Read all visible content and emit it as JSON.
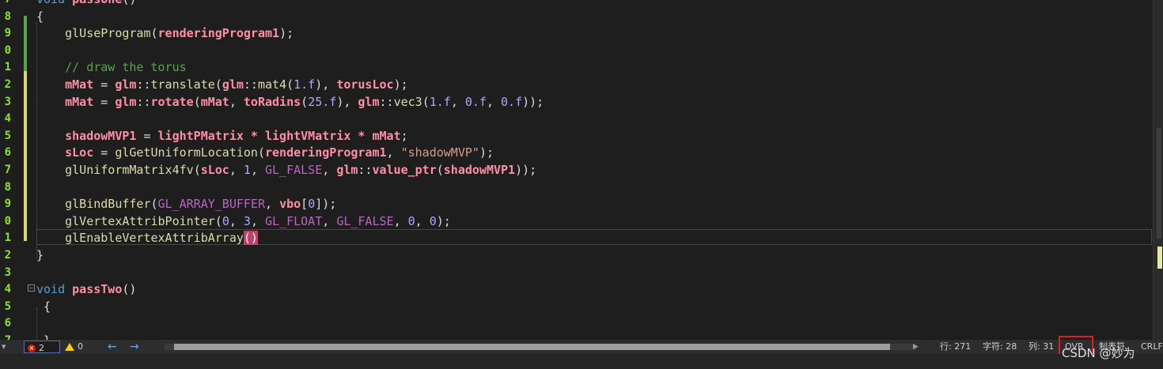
{
  "gutter": {
    "line_numbers": [
      "7",
      "8",
      "9",
      "0",
      "1",
      "2",
      "3",
      "4",
      "5",
      "6",
      "7",
      "8",
      "9",
      "0",
      "1",
      "2",
      "3",
      "4",
      "5",
      "6",
      "7"
    ]
  },
  "code": {
    "line0": {
      "kw": "void",
      "fn": "passOne",
      "rest": "()"
    },
    "line1": "{",
    "line2": {
      "fn": "glUseProgram",
      "p1": "(",
      "var": "renderingProgram1",
      "p2": ");"
    },
    "line4": "// draw the torus",
    "line5": {
      "v1": "mMat",
      "op": " = ",
      "ns": "glm",
      "sep": "::",
      "fn": "translate",
      "a": "(",
      "ns2": "glm",
      "sep2": "::",
      "fn2": "mat4",
      "b": "(",
      "n1": "1.f",
      "c": "), ",
      "v2": "torusLoc",
      "d": ");"
    },
    "line6": {
      "v1": "mMat",
      "op": " = ",
      "ns": "glm",
      "sep": "::",
      "fn": "rotate",
      "a": "(",
      "v2": "mMat",
      "b": ", ",
      "fn2": "toRadins",
      "c": "(",
      "n1": "25.f",
      "d": "), ",
      "ns2": "glm",
      "sep2": "::",
      "fn3": "vec3",
      "e": "(",
      "n2": "1.f",
      "f": ", ",
      "n3": "0.f",
      "g": ", ",
      "n4": "0.f",
      "h": "));"
    },
    "line8": {
      "v1": "shadowMVP1",
      "op": " = ",
      "v2": "lightPMatrix",
      "m1": " * ",
      "v3": "lightVMatrix",
      "m2": " * ",
      "v4": "mMat",
      "end": ";"
    },
    "line9": {
      "v1": "sLoc",
      "op": " = ",
      "fn": "glGetUniformLocation",
      "a": "(",
      "v2": "renderingProgram1",
      "b": ", ",
      "str": "\"shadowMVP\"",
      "c": ");"
    },
    "line10": {
      "fn": "glUniformMatrix4fv",
      "a": "(",
      "v1": "sLoc",
      "b": ", ",
      "n1": "1",
      "c": ", ",
      "mac": "GL_FALSE",
      "d": ", ",
      "ns": "glm",
      "sep": "::",
      "fn2": "value_ptr",
      "e": "(",
      "v2": "shadowMVP1",
      "f": "));"
    },
    "line12": {
      "fn": "glBindBuffer",
      "a": "(",
      "mac": "GL_ARRAY_BUFFER",
      "b": ", ",
      "v1": "vbo",
      "c": "[",
      "n1": "0",
      "d": "]);"
    },
    "line13": {
      "fn": "glVertexAttribPointer",
      "a": "(",
      "n1": "0",
      "b": ", ",
      "n2": "3",
      "c": ", ",
      "mac1": "GL_FLOAT",
      "d": ", ",
      "mac2": "GL_FALSE",
      "e": ", ",
      "n3": "0",
      "f": ", ",
      "n4": "0",
      "g": ");"
    },
    "line14": {
      "fn": "glEnableVertexAttribArray",
      "bm": "()"
    },
    "line15": "}",
    "line17": {
      "kw": "void",
      "fn": "passTwo",
      "rest": "()"
    },
    "line18": "{",
    "line20": "}"
  },
  "status": {
    "errors": "2",
    "warnings": "0",
    "row": "行: 271",
    "char": "字符: 28",
    "col": "列: 31",
    "ovr": "OVR",
    "tab": "制表符",
    "eol": "CRLF"
  },
  "watermark": "CSDN @妙为",
  "colors": {
    "line_numbers": "#8ae234",
    "error": "#e51400",
    "warning": "#ffcc00",
    "ovr_highlight": "#e02020"
  }
}
